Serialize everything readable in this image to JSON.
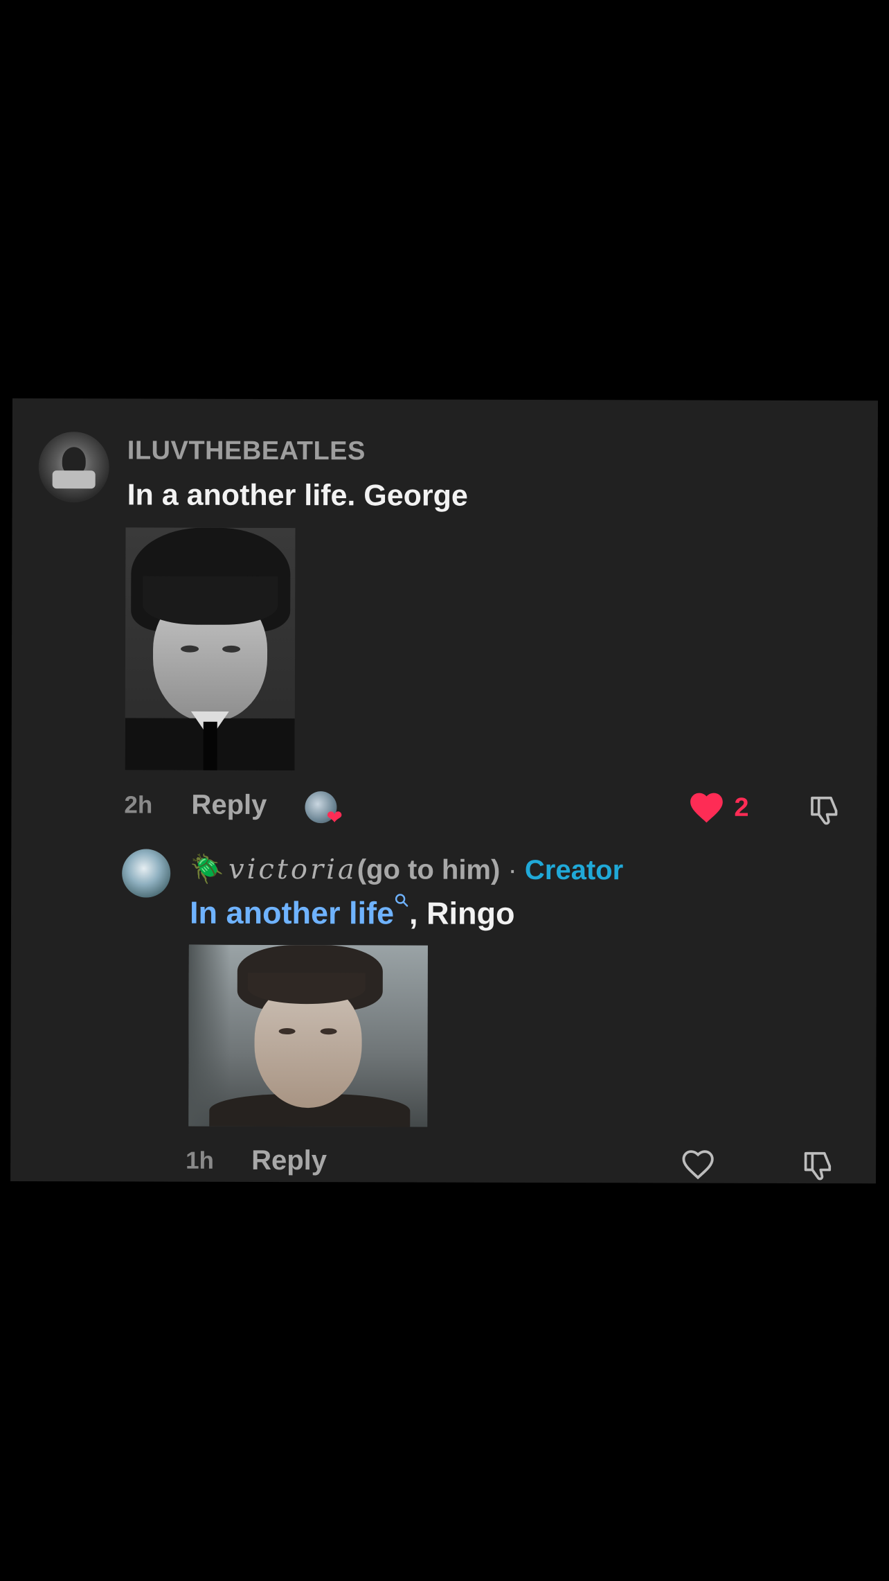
{
  "comment": {
    "username": "ILUVTHEBEATLES",
    "text": "In a another life. George",
    "time": "2h",
    "reply_label": "Reply",
    "likes": "2",
    "liked": true
  },
  "reply": {
    "name_emoji": "🪲",
    "name_script": "victoria",
    "name_suffix": "(go to him)",
    "separator": " · ",
    "badge": "Creator",
    "text_link": "In another life",
    "text_rest": ", Ringo",
    "time": "1h",
    "reply_label": "Reply"
  },
  "colors": {
    "background": "#212121",
    "like_red": "#fe2c55",
    "creator_blue": "#20a9d8",
    "link_blue": "#6fb3ff"
  }
}
